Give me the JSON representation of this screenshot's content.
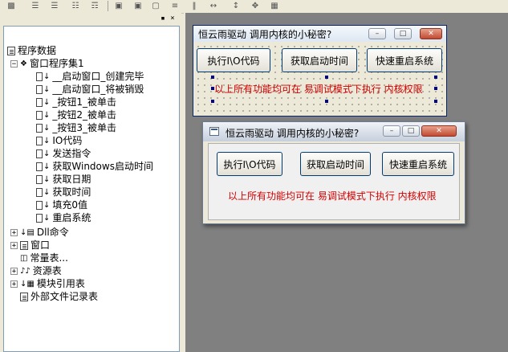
{
  "toolbar": {
    "buttons": [
      "align-left-icon",
      "align-center-icon",
      "align-right-icon",
      "align-top-icon",
      "align-middle-icon",
      "align-bottom-icon",
      "same-width-icon",
      "same-height-icon",
      "same-size-icon",
      "h-spacing-icon",
      "v-spacing-icon",
      "center-h-icon",
      "center-v-icon",
      "center-both-icon"
    ]
  },
  "left_pane": {
    "pin_label": "▪",
    "close_label": "×",
    "tree": {
      "root": "程序数据",
      "window_set": "窗口程序集1",
      "items": [
        "__启动窗口_创建完毕",
        "__启动窗口_将被销毁",
        "_按钮1_被单击",
        "_按钮2_被单击",
        "_按钮3_被单击",
        "IO代码",
        "发送指令",
        "获取Windows启动时间",
        "获取日期",
        "获取时间",
        "填充0值",
        "重启系统"
      ],
      "dll": "Dll命令",
      "window": "窗口",
      "constants": "常量表...",
      "resources": "资源表",
      "modules": "模块引用表",
      "external": "外部文件记录表"
    }
  },
  "design_window": {
    "title": "恒云雨驱动 调用内核的小秘密?",
    "buttons": [
      "执行I\\O代码",
      "获取启动时间",
      "快速重启系统"
    ],
    "note": "以上所有功能均可在 易调试模式下执行 内核权限"
  },
  "run_window": {
    "title": "恒云雨驱动 调用内核的小秘密?",
    "buttons": [
      "执行I\\O代码",
      "获取启动时间",
      "快速重启系统"
    ],
    "note": "以上所有功能均可在 易调试模式下执行 内核权限"
  },
  "caption_buttons": {
    "minimize": "–",
    "maximize": "□",
    "close": "✕"
  },
  "colors": {
    "note_text": "#d40000",
    "canvas": "#808080",
    "selection_handle": "#000080"
  }
}
